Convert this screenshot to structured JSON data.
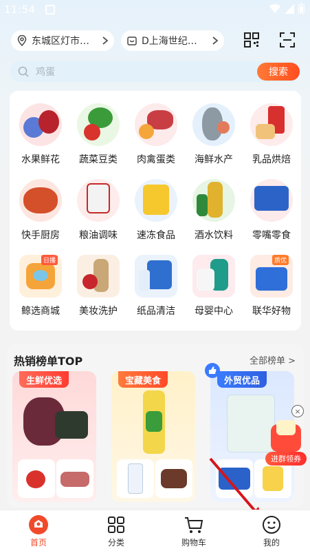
{
  "status_bar": {
    "time": "11:54"
  },
  "header": {
    "location": "东城区灯市…",
    "store": "D上海世纪…"
  },
  "search": {
    "placeholder": "鸡蛋",
    "button": "搜索"
  },
  "categories": [
    {
      "label": "水果鲜花",
      "icon": "fruit-flower-icon"
    },
    {
      "label": "蔬菜豆类",
      "icon": "vegetable-icon"
    },
    {
      "label": "肉禽蛋类",
      "icon": "meat-egg-icon"
    },
    {
      "label": "海鲜水产",
      "icon": "seafood-icon"
    },
    {
      "label": "乳品烘焙",
      "icon": "dairy-bakery-icon"
    },
    {
      "label": "快手厨房",
      "icon": "quick-kitchen-icon"
    },
    {
      "label": "粮油调味",
      "icon": "grain-oil-icon"
    },
    {
      "label": "速冻食品",
      "icon": "frozen-food-icon"
    },
    {
      "label": "酒水饮料",
      "icon": "drinks-icon"
    },
    {
      "label": "零嘴零食",
      "icon": "snacks-icon"
    },
    {
      "label": "鲸选商城",
      "icon": "whale-mall-icon",
      "tag": "日播"
    },
    {
      "label": "美妆洗护",
      "icon": "beauty-care-icon"
    },
    {
      "label": "纸品清洁",
      "icon": "paper-cleaning-icon"
    },
    {
      "label": "母婴中心",
      "icon": "mother-baby-icon"
    },
    {
      "label": "联华好物",
      "icon": "lianhua-goods-icon",
      "tag": "质优"
    }
  ],
  "hot": {
    "title": "热销榜单TOP",
    "all": "全部榜单 >",
    "panels": [
      {
        "badge": "生鲜优选"
      },
      {
        "badge": "宝藏美食"
      },
      {
        "badge": "外贸优品"
      }
    ]
  },
  "coupon": {
    "label": "进群领券",
    "close": "×"
  },
  "nav": [
    {
      "label": "首页"
    },
    {
      "label": "分类"
    },
    {
      "label": "购物车"
    },
    {
      "label": "我的"
    }
  ],
  "colors": {
    "accent": "#f04a2a",
    "search_btn": "#ff5a24"
  }
}
